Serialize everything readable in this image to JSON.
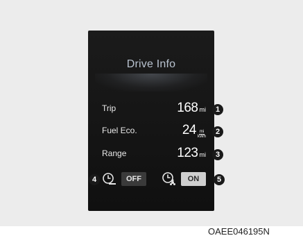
{
  "screen": {
    "title": "Drive Info",
    "rows": [
      {
        "label": "Trip",
        "value": "168",
        "unit": "mi",
        "callout": "1"
      },
      {
        "label": "Fuel Eco.",
        "value": "24",
        "unit_top": "mi",
        "unit_bottom": "kWh",
        "callout": "2"
      },
      {
        "label": "Range",
        "value": "123",
        "unit": "mi",
        "callout": "3"
      }
    ],
    "controls": {
      "left": {
        "icon": "clock-reset-icon",
        "state": "OFF",
        "callout": "4"
      },
      "right": {
        "icon": "clock-fan-icon",
        "state": "ON",
        "callout": "5"
      }
    }
  },
  "caption": "OAEE046195N"
}
